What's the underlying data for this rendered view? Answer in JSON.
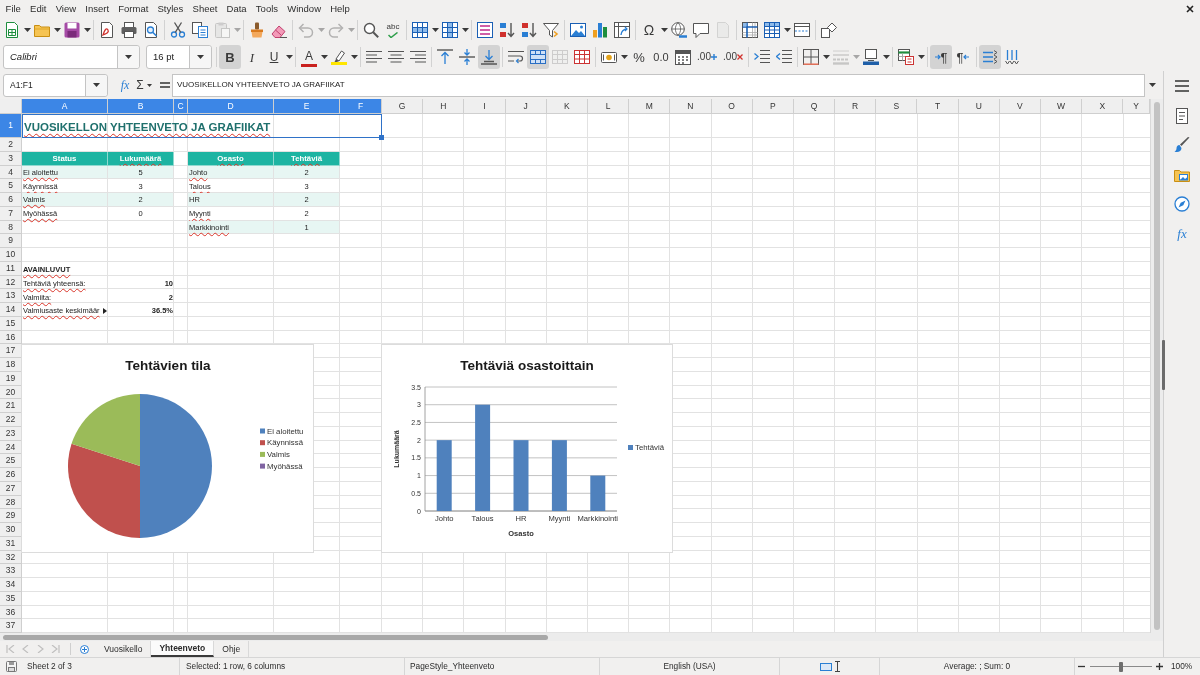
{
  "menu_bar": {
    "items": [
      "File",
      "Edit",
      "View",
      "Insert",
      "Format",
      "Styles",
      "Sheet",
      "Data",
      "Tools",
      "Window",
      "Help"
    ]
  },
  "standard_toolbar": {
    "paste_disabled": true,
    "undo_disabled": true,
    "redo_disabled": true,
    "spelling_glyph": "abc",
    "special_character_glyph": "Ω",
    "header_footer_disabled": true
  },
  "formatting_toolbar": {
    "font_name": "Calibri",
    "font_size": "16 pt",
    "bold": {
      "glyph": "B",
      "on": true
    },
    "italic": {
      "glyph": "I",
      "on": false
    },
    "underline": {
      "glyph": "U",
      "on": false
    },
    "font_color_glyph": "A",
    "align_left": false,
    "align_center": false,
    "align_right": false,
    "align_top": false,
    "align_middle": false,
    "align_bottom": true,
    "wrap_text": false,
    "merge_and_center": true,
    "unmerge_disabled": true,
    "percent_glyph": "%",
    "number_glyph": "0.0",
    "add_decimal_glyph": ".00",
    "delete_decimal_glyph": ".00",
    "border_style_disabled": true,
    "left_to_right": {
      "glyph": "¶",
      "on": true
    },
    "right_to_left": {
      "glyph": "¶",
      "on": false
    },
    "text_horizontal": true,
    "text_vertical": false
  },
  "formula_bar": {
    "name_box": "A1:F1",
    "function_glyph": "fx",
    "sum_glyph": "Σ",
    "content": "VUOSIKELLON YHTEENVETO JA GRAFIIKAT"
  },
  "sidebar": {
    "functions_glyph": "fx"
  },
  "sheet": {
    "columns": [
      {
        "label": "A",
        "selected": true
      },
      {
        "label": "B",
        "selected": true
      },
      {
        "label": "C",
        "selected": true
      },
      {
        "label": "D",
        "selected": true
      },
      {
        "label": "E",
        "selected": true
      },
      {
        "label": "F",
        "selected": true
      },
      {
        "label": "G",
        "selected": false
      },
      {
        "label": "H",
        "selected": false
      },
      {
        "label": "I",
        "selected": false
      },
      {
        "label": "J",
        "selected": false
      },
      {
        "label": "K",
        "selected": false
      },
      {
        "label": "L",
        "selected": false
      },
      {
        "label": "M",
        "selected": false
      },
      {
        "label": "N",
        "selected": false
      },
      {
        "label": "O",
        "selected": false
      },
      {
        "label": "P",
        "selected": false
      },
      {
        "label": "Q",
        "selected": false
      },
      {
        "label": "R",
        "selected": false
      },
      {
        "label": "S",
        "selected": false
      },
      {
        "label": "T",
        "selected": false
      },
      {
        "label": "U",
        "selected": false
      },
      {
        "label": "V",
        "selected": false
      },
      {
        "label": "W",
        "selected": false
      },
      {
        "label": "X",
        "selected": false
      },
      {
        "label": "Y",
        "selected": false
      }
    ],
    "rows": [
      {
        "label": "1",
        "selected": true
      },
      {
        "label": "2",
        "selected": false
      },
      {
        "label": "3",
        "selected": false
      },
      {
        "label": "4",
        "selected": false
      },
      {
        "label": "5",
        "selected": false
      },
      {
        "label": "6",
        "selected": false
      },
      {
        "label": "7",
        "selected": false
      },
      {
        "label": "8",
        "selected": false
      },
      {
        "label": "9",
        "selected": false
      },
      {
        "label": "10",
        "selected": false
      },
      {
        "label": "11",
        "selected": false
      },
      {
        "label": "12",
        "selected": false
      },
      {
        "label": "13",
        "selected": false
      },
      {
        "label": "14",
        "selected": false
      },
      {
        "label": "15",
        "selected": false
      },
      {
        "label": "16",
        "selected": false
      },
      {
        "label": "17",
        "selected": false
      },
      {
        "label": "18",
        "selected": false
      },
      {
        "label": "19",
        "selected": false
      },
      {
        "label": "20",
        "selected": false
      },
      {
        "label": "21",
        "selected": false
      },
      {
        "label": "22",
        "selected": false
      },
      {
        "label": "23",
        "selected": false
      },
      {
        "label": "24",
        "selected": false
      },
      {
        "label": "25",
        "selected": false
      },
      {
        "label": "26",
        "selected": false
      },
      {
        "label": "27",
        "selected": false
      },
      {
        "label": "28",
        "selected": false
      },
      {
        "label": "29",
        "selected": false
      },
      {
        "label": "30",
        "selected": false
      },
      {
        "label": "31",
        "selected": false
      },
      {
        "label": "32",
        "selected": false
      },
      {
        "label": "33",
        "selected": false
      },
      {
        "label": "34",
        "selected": false
      },
      {
        "label": "35",
        "selected": false
      },
      {
        "label": "36",
        "selected": false
      },
      {
        "label": "37",
        "selected": false
      }
    ],
    "title": {
      "text": "VUOSIKELLON YHTEENVETO JA GRAFIIKAT",
      "misspelled": true
    },
    "status_table": {
      "header": [
        {
          "text": "Status",
          "misspelled": false
        },
        {
          "text": "Lukumäärä",
          "misspelled": true
        }
      ],
      "rows": [
        {
          "status": "Ei aloitettu",
          "misspelled": true,
          "count": "5"
        },
        {
          "status": "Käynnissä",
          "misspelled": true,
          "count": "3"
        },
        {
          "status": "Valmis",
          "misspelled": true,
          "count": "2"
        },
        {
          "status": "Myöhässä",
          "misspelled": true,
          "count": "0"
        }
      ]
    },
    "department_table": {
      "header": [
        {
          "text": "Osasto",
          "misspelled": true
        },
        {
          "text": "Tehtäviä",
          "misspelled": true
        }
      ],
      "rows": [
        {
          "department": "Johto",
          "misspelled": true,
          "tasks": "2"
        },
        {
          "department": "Talous",
          "misspelled": true,
          "tasks": "3"
        },
        {
          "department": "HR",
          "misspelled": false,
          "tasks": "2"
        },
        {
          "department": "Myynti",
          "misspelled": true,
          "tasks": "2"
        },
        {
          "department": "Markkinointi",
          "misspelled": true,
          "tasks": "1"
        }
      ]
    },
    "key_figures": {
      "heading": {
        "text": "AVAINLUVUT",
        "misspelled": true
      },
      "rows": [
        {
          "label": "Tehtäviä yhteensä:",
          "misspelled": true,
          "clipped": false,
          "value": "10"
        },
        {
          "label": "Valmiita:",
          "misspelled": true,
          "clipped": false,
          "value": "2"
        },
        {
          "label": "Valmiusaste keskimäär",
          "misspelled": true,
          "clipped": true,
          "value": "36.5%"
        }
      ]
    },
    "charts": [
      {
        "chart_data": {
          "type": "pie",
          "title": "Tehtävien tila",
          "categories": [
            "Ei aloitettu",
            "Käynnissä",
            "Valmis",
            "Myöhässä"
          ],
          "values": [
            50,
            30,
            20,
            0
          ],
          "colors": [
            "#4f81bd",
            "#c0504d",
            "#9bbb59",
            "#8064a2"
          ],
          "legend": "right"
        }
      },
      {
        "chart_data": {
          "type": "bar",
          "title": "Tehtäviä osastoittain",
          "xlabel": "Osasto",
          "ylabel": "Lukumäärä",
          "categories": [
            "Johto",
            "Talous",
            "HR",
            "Myynti",
            "Markkinointi"
          ],
          "series": [
            {
              "name": "Tehtäviä",
              "color": "#4f81bd",
              "values": [
                2,
                3,
                2,
                2,
                1
              ]
            }
          ],
          "ylim": [
            0,
            3.5
          ],
          "yticks": [
            0,
            0.5,
            1,
            1.5,
            2,
            2.5,
            3,
            3.5
          ],
          "grid": true,
          "legend": "right"
        }
      }
    ]
  },
  "sheet_tabs": [
    {
      "label": "Vuosikello",
      "selected": false
    },
    {
      "label": "Yhteenveto",
      "selected": true
    },
    {
      "label": "Ohje",
      "selected": false
    }
  ],
  "status_bar": {
    "sheet_position": "Sheet 2 of 3",
    "selection": "Selected: 1 row, 6 columns",
    "page_style": "PageStyle_Yhteenveto",
    "language": "English (USA)",
    "summary": "Average: ; Sum: 0",
    "zoom": {
      "level": 0.5,
      "reading": "100%"
    }
  }
}
